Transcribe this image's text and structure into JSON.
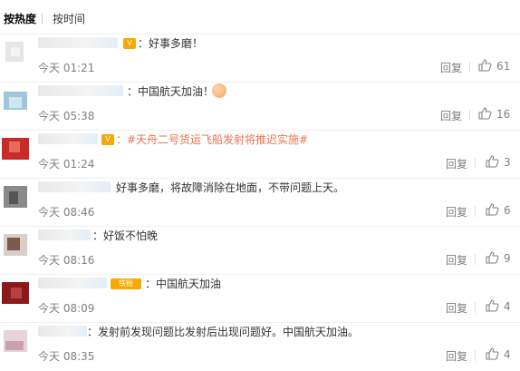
{
  "sort_tabs": {
    "hot": "按热度",
    "time": "按时间"
  },
  "comments": [
    {
      "text": "：好事多磨！",
      "time": "今天 01:21",
      "reply": "回复",
      "likes": "61"
    },
    {
      "text": "：中国航天加油！",
      "time": "今天 05:38",
      "reply": "回复",
      "likes": "16"
    },
    {
      "text": "：#天舟二号货运飞船发射将推迟实施#",
      "time": "今天 01:24",
      "reply": "回复",
      "likes": "3"
    },
    {
      "text": "好事多磨，将故障消除在地面，不带问题上天。",
      "time": "今天 08:46",
      "reply": "回复",
      "likes": "6"
    },
    {
      "text": "：好饭不怕晚",
      "time": "今天 08:16",
      "reply": "回复",
      "likes": "9"
    },
    {
      "text": "：中国航天加油",
      "badge": "铁粉",
      "time": "今天 08:09",
      "reply": "回复",
      "likes": "4"
    },
    {
      "text": "：发射前发现问题比发射后出现问题好。中国航天加油。",
      "time": "今天 08:35",
      "reply": "回复",
      "likes": "4"
    }
  ],
  "colors": {
    "topic": "#eb7350",
    "meta": "#808080",
    "text": "#333333"
  },
  "icons": {
    "like": "thumbs-up-icon",
    "vip": "vip-badge-icon"
  }
}
